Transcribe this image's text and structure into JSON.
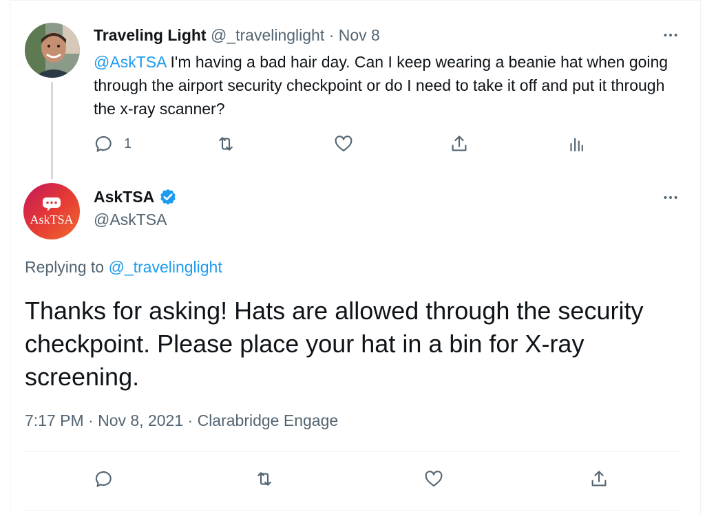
{
  "parent_tweet": {
    "display_name": "Traveling Light",
    "handle": "@_travelinglight",
    "separator": "·",
    "date": "Nov 8",
    "mention": "@AskTSA",
    "text": " I'm having a bad hair day. Can I keep wearing a beanie hat when going through the airport security checkpoint or do I need to take it off and put it through the x-ray scanner?",
    "reply_count": "1",
    "actions": [
      "reply-icon",
      "retweet-icon",
      "like-icon",
      "share-icon",
      "analytics-icon"
    ]
  },
  "reply_tweet": {
    "display_name": "AskTSA",
    "handle": "@AskTSA",
    "avatar_text": "AskTSA",
    "replying_prefix": "Replying to ",
    "replying_to": "@_travelinglight",
    "text": "Thanks for asking! Hats are allowed through the security checkpoint. Please place your hat in a bin for X-ray screening.",
    "timestamp": "7:17 PM · Nov 8, 2021 · ",
    "source": "Clarabridge Engage",
    "actions": [
      "reply-icon",
      "retweet-icon",
      "like-icon",
      "share-icon"
    ]
  },
  "colors": {
    "accent": "#1d9bf0",
    "text": "#0f1419",
    "muted": "#536471",
    "avatar_gradient_start": "#c2185b",
    "avatar_gradient_end": "#f26a2e"
  }
}
